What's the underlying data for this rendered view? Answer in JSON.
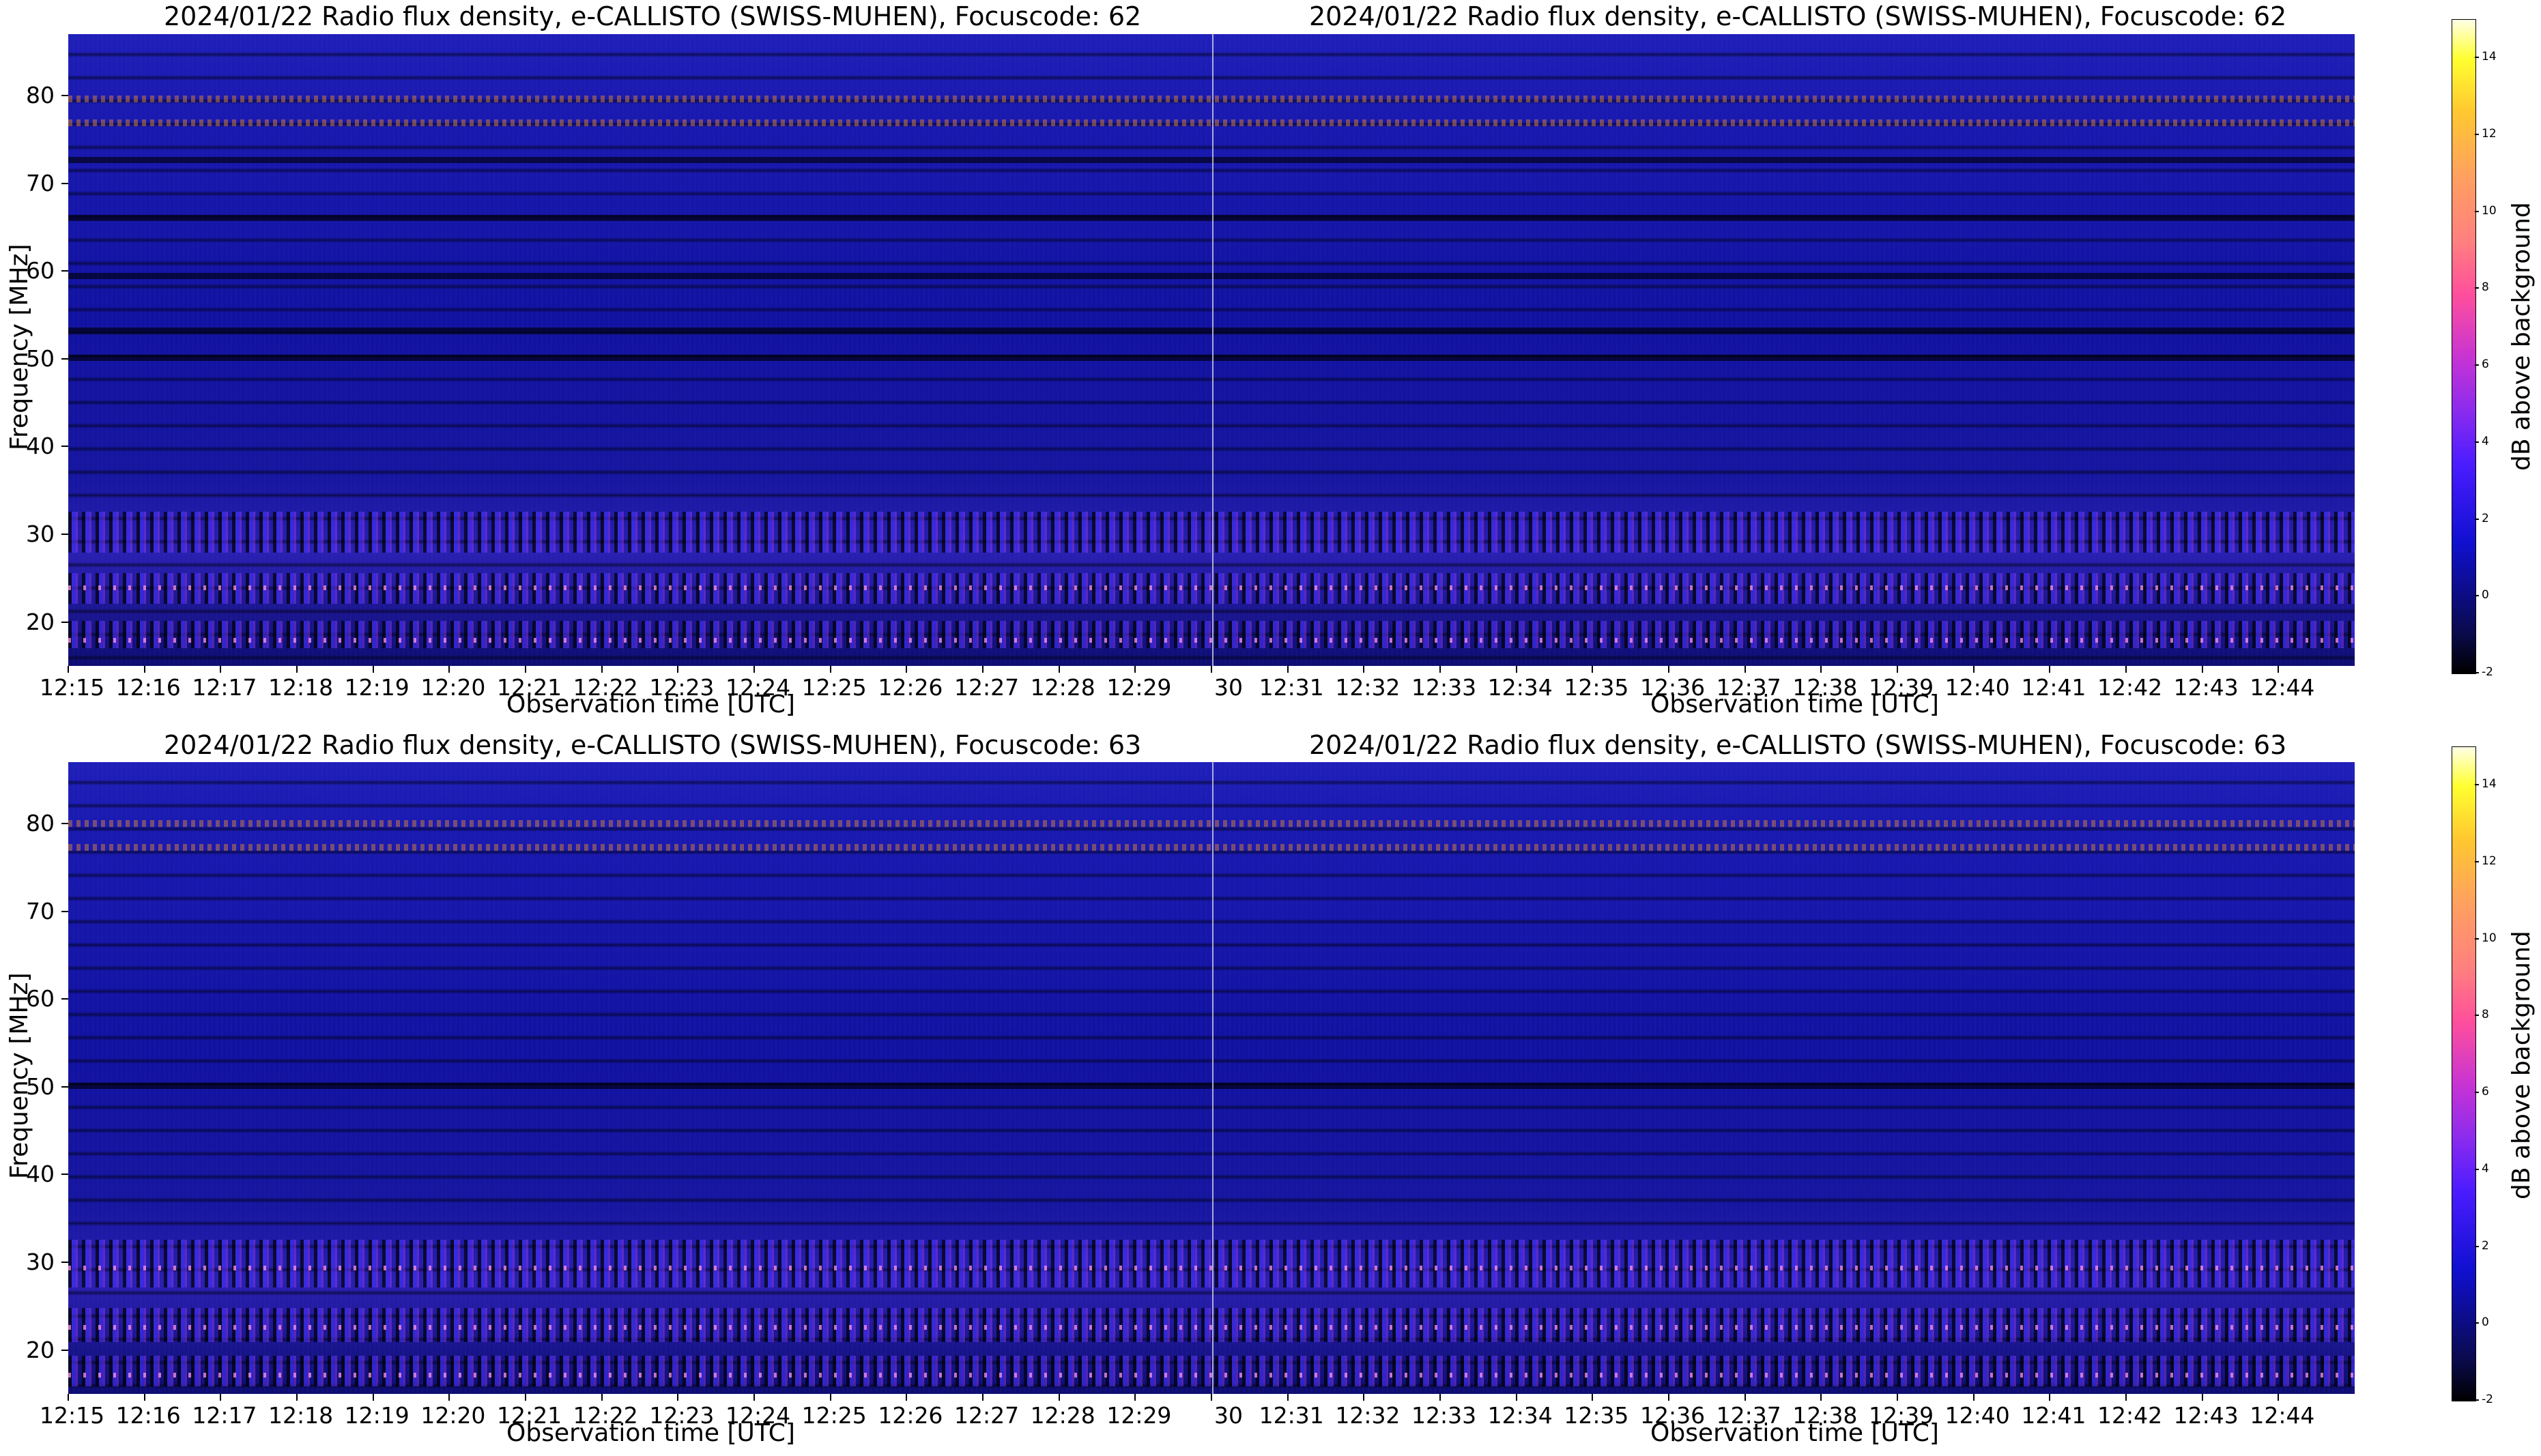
{
  "colors": {
    "background": "#ffffff",
    "spectrogram_base": "#1414a8",
    "colormap": [
      "#000000",
      "#1010d0",
      "#8a2bee",
      "#ff4f9c",
      "#ffa060",
      "#ffff30",
      "#ffffe6"
    ]
  },
  "chart_data": [
    {
      "type": "heatmap",
      "title": "2024/01/22  Radio flux density, e-CALLISTO (SWISS-MUHEN), Focuscode: 62",
      "xlabel": "Observation time [UTC]",
      "ylabel": "Frequency [MHz]",
      "ylim": [
        15,
        87
      ],
      "yticks": [
        20,
        30,
        40,
        50,
        60,
        70,
        80
      ],
      "xticks": [
        "12:15",
        "12:16",
        "12:17",
        "12:18",
        "12:19",
        "12:20",
        "12:21",
        "12:22",
        "12:23",
        "12:24",
        "12:25",
        "12:26",
        "12:27",
        "12:28",
        "12:29"
      ],
      "colorbar_label": "dB above background",
      "colorbar_range": [
        -2,
        15
      ],
      "colorbar_ticks": [
        "-2",
        "0",
        "2",
        "4",
        "6",
        "8",
        "10",
        "12",
        "14"
      ]
    },
    {
      "type": "heatmap",
      "title": "2024/01/22  Radio flux density, e-CALLISTO (SWISS-MUHEN), Focuscode: 62",
      "xlabel": "Observation time [UTC]",
      "ylabel": "",
      "ylim": [
        15,
        87
      ],
      "xticks": [
        "30",
        "12:31",
        "12:32",
        "12:33",
        "12:34",
        "12:35",
        "12:36",
        "12:37",
        "12:38",
        "12:39",
        "12:40",
        "12:41",
        "12:42",
        "12:43",
        "12:44"
      ]
    },
    {
      "type": "heatmap",
      "title": "2024/01/22  Radio flux density, e-CALLISTO (SWISS-MUHEN), Focuscode: 63",
      "xlabel": "Observation time [UTC]",
      "ylabel": "Frequency [MHz]",
      "ylim": [
        15,
        87
      ],
      "yticks": [
        20,
        30,
        40,
        50,
        60,
        70,
        80
      ],
      "xticks": [
        "12:15",
        "12:16",
        "12:17",
        "12:18",
        "12:19",
        "12:20",
        "12:21",
        "12:22",
        "12:23",
        "12:24",
        "12:25",
        "12:26",
        "12:27",
        "12:28",
        "12:29"
      ],
      "colorbar_label": "dB above background",
      "colorbar_range": [
        -2,
        15
      ],
      "colorbar_ticks": [
        "-2",
        "0",
        "2",
        "4",
        "6",
        "8",
        "10",
        "12",
        "14"
      ]
    },
    {
      "type": "heatmap",
      "title": "2024/01/22  Radio flux density, e-CALLISTO (SWISS-MUHEN), Focuscode: 63",
      "xlabel": "Observation time [UTC]",
      "ylabel": "",
      "ylim": [
        15,
        87
      ],
      "xticks": [
        "30",
        "12:31",
        "12:32",
        "12:33",
        "12:34",
        "12:35",
        "12:36",
        "12:37",
        "12:38",
        "12:39",
        "12:40",
        "12:41",
        "12:42",
        "12:43",
        "12:44"
      ]
    }
  ]
}
